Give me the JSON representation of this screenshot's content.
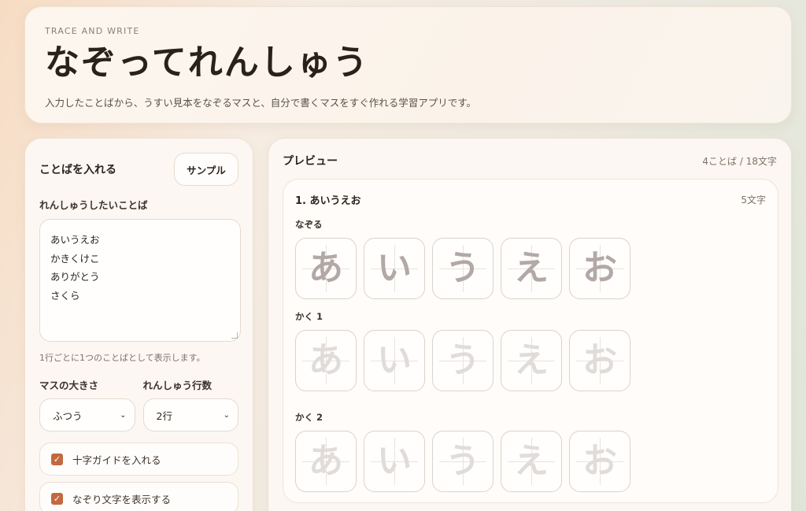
{
  "header": {
    "eyebrow": "TRACE AND WRITE",
    "title": "なぞってれんしゅう",
    "description": "入力したことばから、うすい見本をなぞるマスと、自分で書くマスをすぐ作れる学習アプリです。"
  },
  "input_panel": {
    "title": "ことばを入れる",
    "sample_button": "サンプル",
    "words_label": "れんしゅうしたいことば",
    "words": [
      "あいうえお",
      "かきくけこ",
      "ありがとう",
      "さくら"
    ],
    "hint": "1行ごとに1つのことばとして表示します。",
    "cell_size_label": "マスの大きさ",
    "cell_size_value": "ふつう",
    "practice_rows_label": "れんしゅう行数",
    "practice_rows_value": "2行",
    "guide_checkbox_label": "十字ガイドを入れる",
    "guide_checked": true,
    "trace_checkbox_label": "なぞり文字を表示する",
    "trace_checked": true
  },
  "preview": {
    "title": "プレビュー",
    "summary": "4ことば / 18文字",
    "card": {
      "title": "1. あいうえお",
      "char_count": "5文字",
      "trace_label": "なぞる",
      "write1_label": "かく 1",
      "write2_label": "かく 2",
      "characters": [
        "あ",
        "い",
        "う",
        "え",
        "お"
      ]
    }
  },
  "colors": {
    "accent": "#c1693f",
    "trace_glyph": "#b2a8a6",
    "write_glyph": "#e1dcd9"
  }
}
